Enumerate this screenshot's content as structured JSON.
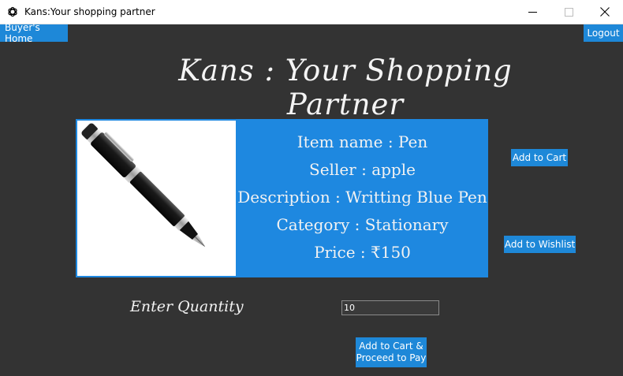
{
  "window": {
    "title": "Kans:Your shopping partner",
    "controls": {
      "minimize": "—",
      "maximize": "☐",
      "close": "✕"
    }
  },
  "nav": {
    "home_label": "Buyer's Home",
    "logout_label": "Logout"
  },
  "heading": "Kans : Your Shopping Partner",
  "product": {
    "image_icon": "pen-icon",
    "lines": [
      "Item name : Pen",
      "Seller : apple",
      "Description : Writting Blue Pen",
      "Category : Stationary",
      "Price : ₹150"
    ]
  },
  "actions": {
    "add_to_cart": "Add to Cart",
    "add_to_wishlist": "Add to Wishlist",
    "proceed_line1": "Add to Cart &",
    "proceed_line2": "Proceed to Pay"
  },
  "quantity": {
    "label": "Enter Quantity",
    "value": "10"
  },
  "colors": {
    "background": "#333333",
    "accent": "#1e88d8"
  }
}
